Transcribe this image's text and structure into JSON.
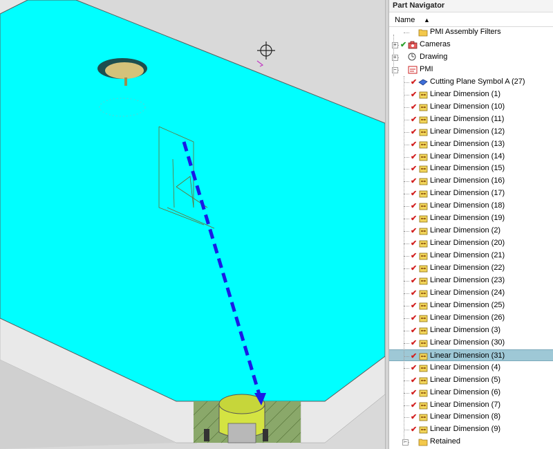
{
  "navigator": {
    "title": "Part Navigator",
    "column_name": "Name",
    "sort_arrow": "▲",
    "items": [
      {
        "label": "PMI Assembly Filters",
        "indent": 2,
        "icon": "folder-icon",
        "check": ""
      },
      {
        "label": "Cameras",
        "indent": 1,
        "icon": "camera-icon",
        "check": "green",
        "expander": "+"
      },
      {
        "label": "Drawing",
        "indent": 1,
        "icon": "drawing-icon",
        "check": "",
        "expander": "+"
      },
      {
        "label": "PMI",
        "indent": 1,
        "icon": "pmi-icon",
        "check": "",
        "expander": "−"
      },
      {
        "label": "Cutting Plane Symbol A (27)",
        "indent": 2,
        "icon": "cutting-plane-icon",
        "check": "red"
      },
      {
        "label": "Linear Dimension (1)",
        "indent": 2,
        "icon": "dimension-icon",
        "check": "red"
      },
      {
        "label": "Linear Dimension (10)",
        "indent": 2,
        "icon": "dimension-icon",
        "check": "red"
      },
      {
        "label": "Linear Dimension (11)",
        "indent": 2,
        "icon": "dimension-icon",
        "check": "red"
      },
      {
        "label": "Linear Dimension (12)",
        "indent": 2,
        "icon": "dimension-icon",
        "check": "red"
      },
      {
        "label": "Linear Dimension (13)",
        "indent": 2,
        "icon": "dimension-icon",
        "check": "red"
      },
      {
        "label": "Linear Dimension (14)",
        "indent": 2,
        "icon": "dimension-icon",
        "check": "red"
      },
      {
        "label": "Linear Dimension (15)",
        "indent": 2,
        "icon": "dimension-icon",
        "check": "red"
      },
      {
        "label": "Linear Dimension (16)",
        "indent": 2,
        "icon": "dimension-icon",
        "check": "red"
      },
      {
        "label": "Linear Dimension (17)",
        "indent": 2,
        "icon": "dimension-icon",
        "check": "red"
      },
      {
        "label": "Linear Dimension (18)",
        "indent": 2,
        "icon": "dimension-icon",
        "check": "red"
      },
      {
        "label": "Linear Dimension (19)",
        "indent": 2,
        "icon": "dimension-icon",
        "check": "red"
      },
      {
        "label": "Linear Dimension (2)",
        "indent": 2,
        "icon": "dimension-icon",
        "check": "red"
      },
      {
        "label": "Linear Dimension (20)",
        "indent": 2,
        "icon": "dimension-icon",
        "check": "red"
      },
      {
        "label": "Linear Dimension (21)",
        "indent": 2,
        "icon": "dimension-icon",
        "check": "red"
      },
      {
        "label": "Linear Dimension (22)",
        "indent": 2,
        "icon": "dimension-icon",
        "check": "red"
      },
      {
        "label": "Linear Dimension (23)",
        "indent": 2,
        "icon": "dimension-icon",
        "check": "red"
      },
      {
        "label": "Linear Dimension (24)",
        "indent": 2,
        "icon": "dimension-icon",
        "check": "red"
      },
      {
        "label": "Linear Dimension (25)",
        "indent": 2,
        "icon": "dimension-icon",
        "check": "red"
      },
      {
        "label": "Linear Dimension (26)",
        "indent": 2,
        "icon": "dimension-icon",
        "check": "red"
      },
      {
        "label": "Linear Dimension (3)",
        "indent": 2,
        "icon": "dimension-icon",
        "check": "red"
      },
      {
        "label": "Linear Dimension (30)",
        "indent": 2,
        "icon": "dimension-icon",
        "check": "red"
      },
      {
        "label": "Linear Dimension (31)",
        "indent": 2,
        "icon": "dimension-icon",
        "check": "red",
        "selected": true
      },
      {
        "label": "Linear Dimension (4)",
        "indent": 2,
        "icon": "dimension-icon",
        "check": "red"
      },
      {
        "label": "Linear Dimension (5)",
        "indent": 2,
        "icon": "dimension-icon",
        "check": "red"
      },
      {
        "label": "Linear Dimension (6)",
        "indent": 2,
        "icon": "dimension-icon",
        "check": "red"
      },
      {
        "label": "Linear Dimension (7)",
        "indent": 2,
        "icon": "dimension-icon",
        "check": "red"
      },
      {
        "label": "Linear Dimension (8)",
        "indent": 2,
        "icon": "dimension-icon",
        "check": "red"
      },
      {
        "label": "Linear Dimension (9)",
        "indent": 2,
        "icon": "dimension-icon",
        "check": "red"
      },
      {
        "label": "Retained",
        "indent": 2,
        "icon": "folder-icon",
        "check": "",
        "expander": "−"
      }
    ]
  },
  "colors": {
    "part_top": "#00ffff",
    "part_side": "#e3e3e3",
    "arrow": "#1a1ae6",
    "selection": "#9ec8d6",
    "boss": "#d7e64a"
  }
}
